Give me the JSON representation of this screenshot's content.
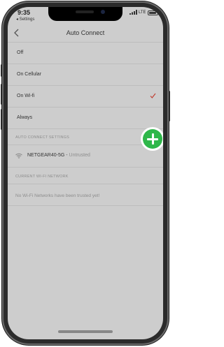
{
  "status_bar": {
    "time": "9:35",
    "back_app": "◂ Settings",
    "carrier": "LTE"
  },
  "nav": {
    "title": "Auto Connect"
  },
  "options": [
    {
      "label": "Off",
      "selected": false
    },
    {
      "label": "On Cellular",
      "selected": false
    },
    {
      "label": "On Wi-fi",
      "selected": true
    },
    {
      "label": "Always",
      "selected": false
    }
  ],
  "auto_connect_settings": {
    "header": "AUTO CONNECT SETTINGS",
    "network": {
      "name": "NETGEAR40-5G",
      "separator": " - ",
      "status": "Untrusted"
    }
  },
  "current_network": {
    "header": "CURRENT WI-FI NETWORK",
    "empty_message": "No Wi-Fi Networks have been trusted yet!"
  },
  "colors": {
    "accent_check": "#c0392b",
    "add_button": "#2fb74a",
    "screen_dim": "#cdcdcd"
  },
  "icons": [
    "back-chevron-icon",
    "check-icon",
    "wifi-icon",
    "add-icon",
    "battery-icon",
    "signal-icon"
  ]
}
